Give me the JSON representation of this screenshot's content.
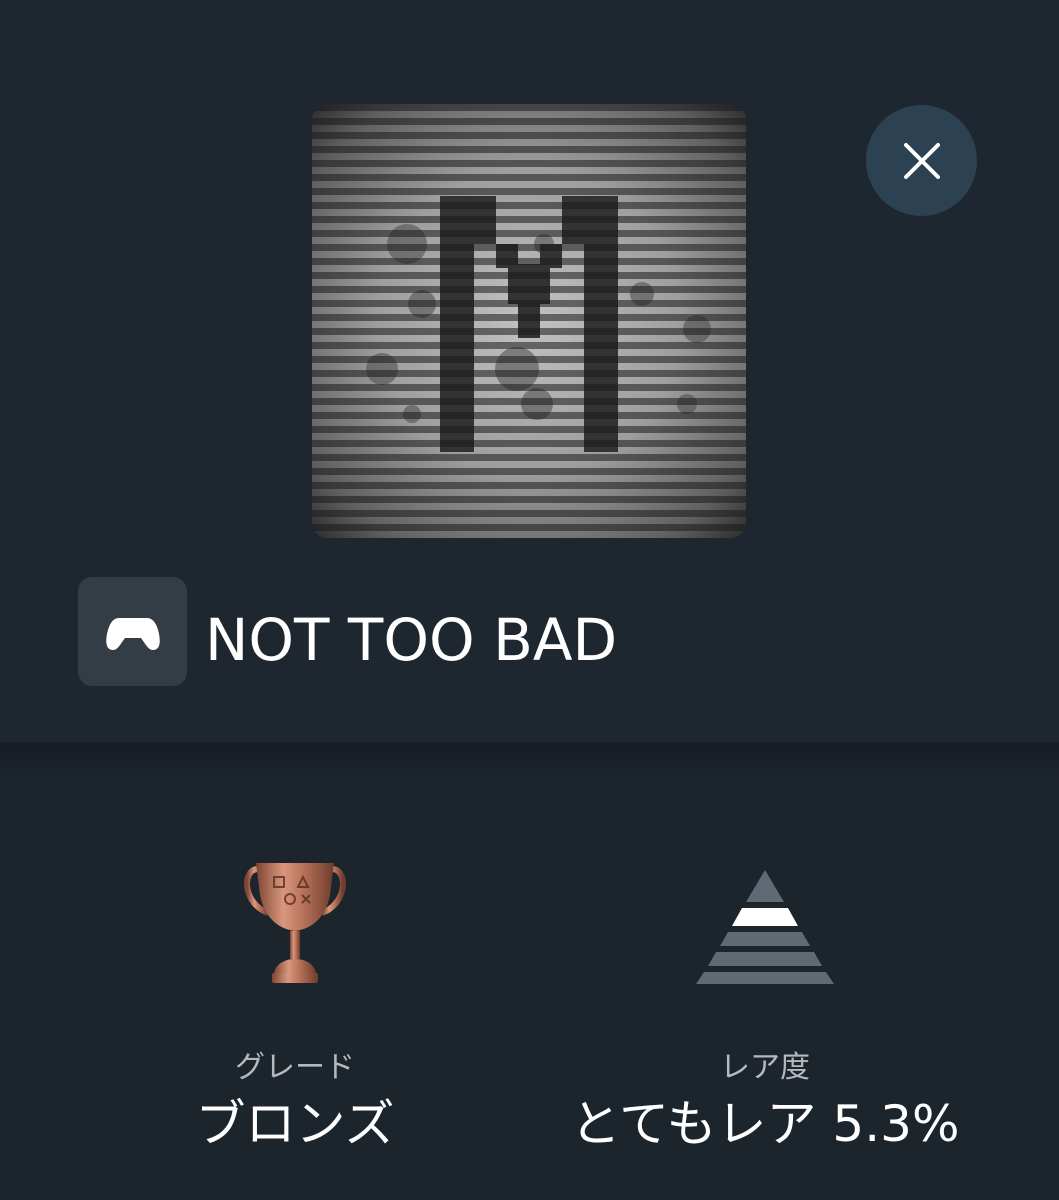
{
  "trophy": {
    "title": "NOT TOO BAD",
    "artwork_icon": "m-glyph-scanline-icon",
    "platform_icon": "gamepad-icon"
  },
  "close_icon": "close-icon",
  "grade": {
    "label": "グレード",
    "value": "ブロンズ",
    "icon": "bronze-trophy-icon",
    "color": "#b8735a"
  },
  "rarity": {
    "label": "レア度",
    "value": "とてもレア 5.3%",
    "icon": "rarity-pyramid-icon",
    "percent": 5.3
  },
  "colors": {
    "background": "#1c242c",
    "close_button": "#2c4252",
    "badge": "#343d45"
  }
}
